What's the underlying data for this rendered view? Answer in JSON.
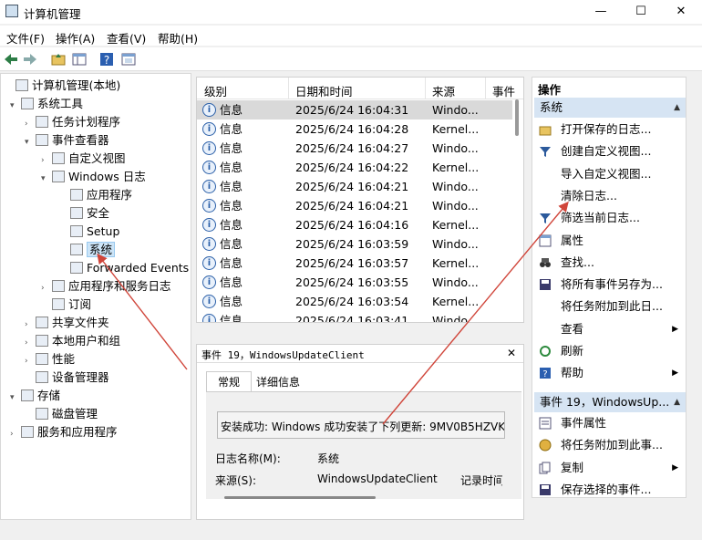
{
  "window": {
    "title": "计算机管理",
    "minimize": "—",
    "maximize": "☐",
    "close": "✕"
  },
  "menu": [
    "文件(F)",
    "操作(A)",
    "查看(V)",
    "帮助(H)"
  ],
  "toolbar": [
    "back-arrow-icon",
    "forward-arrow-icon",
    "up-folder-icon",
    "show-hide-tree-icon",
    "help-icon",
    "properties-icon"
  ],
  "tree": [
    {
      "label": "计算机管理(本地)",
      "icon": "computer-management-icon",
      "level": 0,
      "expander": ""
    },
    {
      "label": "系统工具",
      "icon": "tools-icon",
      "level": 1,
      "expander": "v"
    },
    {
      "label": "任务计划程序",
      "icon": "clock-icon",
      "level": 2,
      "expander": ">"
    },
    {
      "label": "事件查看器",
      "icon": "event-viewer-icon",
      "level": 2,
      "expander": "v"
    },
    {
      "label": "自定义视图",
      "icon": "folder-icon",
      "level": 3,
      "expander": ">"
    },
    {
      "label": "Windows 日志",
      "icon": "folder-icon",
      "level": 3,
      "expander": "v"
    },
    {
      "label": "应用程序",
      "icon": "log-icon",
      "level": 4,
      "expander": ""
    },
    {
      "label": "安全",
      "icon": "log-icon",
      "level": 4,
      "expander": ""
    },
    {
      "label": "Setup",
      "icon": "log-icon",
      "level": 4,
      "expander": ""
    },
    {
      "label": "系统",
      "icon": "log-icon",
      "level": 4,
      "expander": "",
      "selected": true
    },
    {
      "label": "Forwarded Events",
      "icon": "log-icon",
      "level": 4,
      "expander": ""
    },
    {
      "label": "应用程序和服务日志",
      "icon": "folder-icon",
      "level": 3,
      "expander": ">"
    },
    {
      "label": "订阅",
      "icon": "subscription-icon",
      "level": 3,
      "expander": ""
    },
    {
      "label": "共享文件夹",
      "icon": "shared-folder-icon",
      "level": 2,
      "expander": ">"
    },
    {
      "label": "本地用户和组",
      "icon": "users-icon",
      "level": 2,
      "expander": ">"
    },
    {
      "label": "性能",
      "icon": "performance-icon",
      "level": 2,
      "expander": ">"
    },
    {
      "label": "设备管理器",
      "icon": "device-manager-icon",
      "level": 2,
      "expander": ""
    },
    {
      "label": "存储",
      "icon": "storage-icon",
      "level": 1,
      "expander": "v"
    },
    {
      "label": "磁盘管理",
      "icon": "disk-icon",
      "level": 2,
      "expander": ""
    },
    {
      "label": "服务和应用程序",
      "icon": "services-icon",
      "level": 1,
      "expander": ">"
    }
  ],
  "events": {
    "columns": [
      "级别",
      "日期和时间",
      "来源",
      "事件"
    ],
    "rows": [
      {
        "level": "信息",
        "datetime": "2025/6/24 16:04:31",
        "source": "Windo...",
        "selected": true
      },
      {
        "level": "信息",
        "datetime": "2025/6/24 16:04:28",
        "source": "Kernel..."
      },
      {
        "level": "信息",
        "datetime": "2025/6/24 16:04:27",
        "source": "Windo..."
      },
      {
        "level": "信息",
        "datetime": "2025/6/24 16:04:22",
        "source": "Kernel..."
      },
      {
        "level": "信息",
        "datetime": "2025/6/24 16:04:21",
        "source": "Windo..."
      },
      {
        "level": "信息",
        "datetime": "2025/6/24 16:04:21",
        "source": "Windo..."
      },
      {
        "level": "信息",
        "datetime": "2025/6/24 16:04:16",
        "source": "Kernel..."
      },
      {
        "level": "信息",
        "datetime": "2025/6/24 16:03:59",
        "source": "Windo..."
      },
      {
        "level": "信息",
        "datetime": "2025/6/24 16:03:57",
        "source": "Kernel..."
      },
      {
        "level": "信息",
        "datetime": "2025/6/24 16:03:55",
        "source": "Windo..."
      },
      {
        "level": "信息",
        "datetime": "2025/6/24 16:03:54",
        "source": "Kernel..."
      },
      {
        "level": "信息",
        "datetime": "2025/6/24 16:03:41",
        "source": "Windo..."
      }
    ]
  },
  "detail": {
    "title": "事件 19，WindowsUpdateClient",
    "close": "✕",
    "tabs": [
      "常规",
      "详细信息"
    ],
    "message": "安装成功: Windows 成功安装了下列更新: 9MV0B5HZVK",
    "fields": [
      {
        "label": "日志名称(M):",
        "value": "系统"
      },
      {
        "label": "来源(S):",
        "value": "WindowsUpdateClient",
        "extra": "记录时间"
      }
    ]
  },
  "actions": {
    "header": "操作",
    "section1": "系统",
    "items1": [
      {
        "label": "打开保存的日志...",
        "icon": "open-log-icon"
      },
      {
        "label": "创建自定义视图...",
        "icon": "filter-icon"
      },
      {
        "label": "导入自定义视图...",
        "icon": ""
      },
      {
        "label": "清除日志...",
        "icon": ""
      },
      {
        "label": "筛选当前日志...",
        "icon": "filter-icon"
      },
      {
        "label": "属性",
        "icon": "properties-icon"
      },
      {
        "label": "查找...",
        "icon": "binoculars-icon"
      },
      {
        "label": "将所有事件另存为...",
        "icon": "save-icon"
      },
      {
        "label": "将任务附加到此日...",
        "icon": ""
      },
      {
        "label": "查看",
        "icon": "",
        "submenu": true
      },
      {
        "label": "刷新",
        "icon": "refresh-icon"
      },
      {
        "label": "帮助",
        "icon": "help-icon",
        "submenu": true
      }
    ],
    "section2": "事件 19，WindowsUp...",
    "items2": [
      {
        "label": "事件属性",
        "icon": "event-properties-icon"
      },
      {
        "label": "将任务附加到此事...",
        "icon": "task-icon"
      },
      {
        "label": "复制",
        "icon": "copy-icon",
        "submenu": true
      },
      {
        "label": "保存选择的事件...",
        "icon": "save-icon"
      }
    ]
  },
  "colors": {
    "selection": "#cce4f7",
    "section_header": "#d6e4f3",
    "annotation_arrow": "#d0453a"
  }
}
